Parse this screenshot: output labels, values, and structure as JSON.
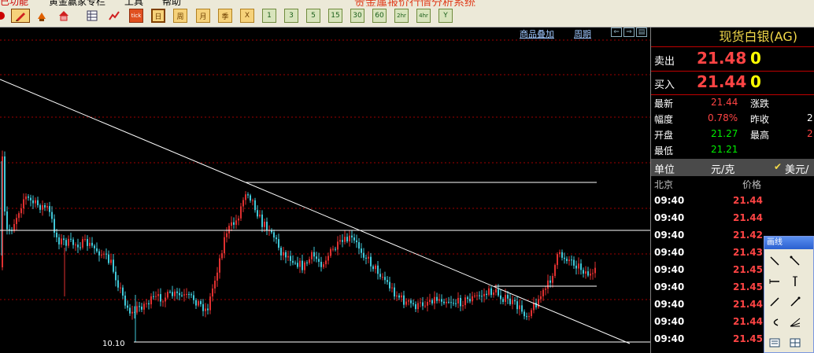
{
  "menubar": {
    "items": [
      "已功能",
      "黄金赢家专栏",
      "工具",
      "帮助"
    ],
    "app_title": "贵金属报价行情分析系统"
  },
  "toolbar": {
    "periods": [
      "日",
      "周",
      "月",
      "季",
      "X",
      "1",
      "3",
      "5",
      "15",
      "30",
      "60",
      "2hr",
      "4hr",
      "Y"
    ],
    "tick_label": "tick",
    "active_period": "日"
  },
  "chart": {
    "overlay_link": "商品叠加",
    "period_link": "周期",
    "low_label": "10.10",
    "type": "candlestick",
    "colors": {
      "up": "#e03030",
      "down": "#40c8d8",
      "grid": "#a00000",
      "trendline": "#ffffff"
    }
  },
  "quote": {
    "title": "现货白银(AG)",
    "sell_label": "卖出",
    "sell_price": "21.48",
    "sell_qty": "0",
    "buy_label": "买入",
    "buy_price": "21.44",
    "buy_qty": "0",
    "stats": {
      "latest_label": "最新",
      "latest": "21.44",
      "change_label": "涨跌",
      "range_label": "幅度",
      "range": "0.78%",
      "prev_close_label": "昨收",
      "prev_close_partial": "2",
      "open_label": "开盘",
      "open": "21.27",
      "high_label": "最高",
      "high_partial": "2",
      "low_label": "最低",
      "low": "21.21"
    },
    "unit_label": "单位",
    "unit_value": "元/克",
    "currency": "美元/"
  },
  "ticks": {
    "location_header": "北京",
    "price_header": "价格",
    "rows": [
      {
        "time": "09:40",
        "price": "21.44"
      },
      {
        "time": "09:40",
        "price": "21.44"
      },
      {
        "time": "09:40",
        "price": "21.42"
      },
      {
        "time": "09:40",
        "price": "21.43"
      },
      {
        "time": "09:40",
        "price": "21.45"
      },
      {
        "time": "09:40",
        "price": "21.45"
      },
      {
        "time": "09:40",
        "price": "21.44"
      },
      {
        "time": "09:40",
        "price": "21.44"
      },
      {
        "time": "09:40",
        "price": "21.45"
      }
    ]
  },
  "draw_tool": {
    "title": "画线"
  }
}
